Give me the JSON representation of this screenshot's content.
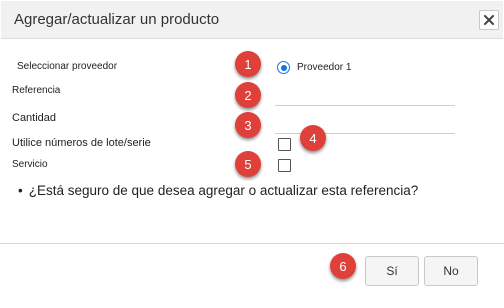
{
  "dialog": {
    "title": "Agregar/actualizar un producto",
    "close_icon": "close-icon"
  },
  "form": {
    "proveedor_label": "Seleccionar proveedor",
    "proveedor_option": "Proveedor 1",
    "proveedor_selected": true,
    "referencia_label": "Referencia",
    "referencia_value": "",
    "cantidad_label": "Cantidad",
    "cantidad_value": "",
    "lote_label": "Utilice números de lote/serie",
    "lote_checked": false,
    "servicio_label": "Servicio",
    "servicio_checked": false
  },
  "question": {
    "bullet": "•",
    "text": "¿Está seguro de que desea agregar o actualizar esta referencia?"
  },
  "badges": [
    "1",
    "2",
    "3",
    "4",
    "5",
    "6"
  ],
  "buttons": {
    "yes_label": "Sí",
    "no_label": "No"
  },
  "colors": {
    "accent": "#1473e6",
    "badge": "#e0403a",
    "titlebar": "#f1f1f1"
  }
}
